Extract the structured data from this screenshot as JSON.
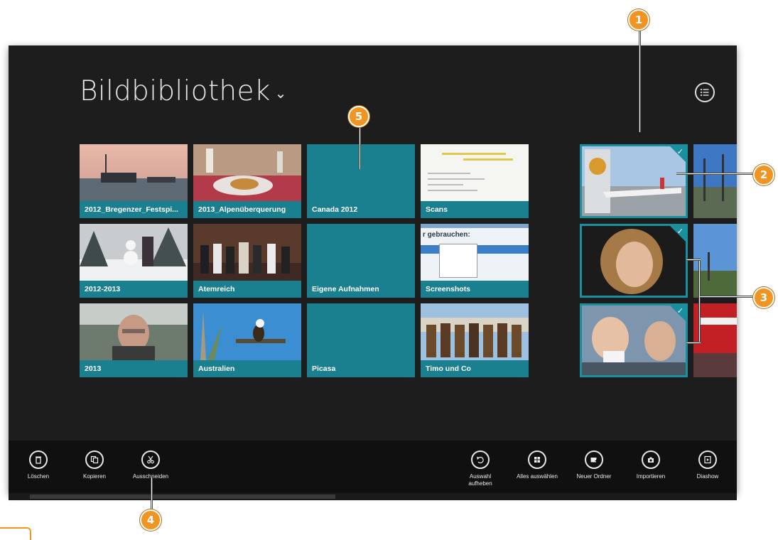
{
  "page": {
    "title": "Bildbibliothek",
    "title_chevron": "⌄"
  },
  "folders": [
    {
      "label": "2012_Bregenzer_Festspi..."
    },
    {
      "label": "2013_Alpenüberquerung"
    },
    {
      "label": "Canada 2012"
    },
    {
      "label": "Scans"
    },
    {
      "label": "2012-2013"
    },
    {
      "label": "Atemreich"
    },
    {
      "label": "Eigene Aufnahmen"
    },
    {
      "label": "Screenshots"
    },
    {
      "label": "2013"
    },
    {
      "label": "Australien"
    },
    {
      "label": "Picasa"
    },
    {
      "label": "Timo und Co"
    }
  ],
  "photo_check": "✓",
  "appbar": {
    "left": [
      {
        "label": "Löschen"
      },
      {
        "label": "Kopieren"
      },
      {
        "label": "Ausschneiden"
      }
    ],
    "right": [
      {
        "label": "Auswahl aufheben"
      },
      {
        "label": "Alles auswählen"
      },
      {
        "label": "Neuer Ordner"
      },
      {
        "label": "Importieren"
      },
      {
        "label": "Diashow"
      }
    ]
  },
  "callouts": [
    "1",
    "2",
    "3",
    "4",
    "5"
  ],
  "screenshot_texts": {
    "line": "r gebrauchen:"
  },
  "colors": {
    "accent": "#1a7f8f",
    "callout": "#f29421",
    "background": "#1d1d1d"
  }
}
